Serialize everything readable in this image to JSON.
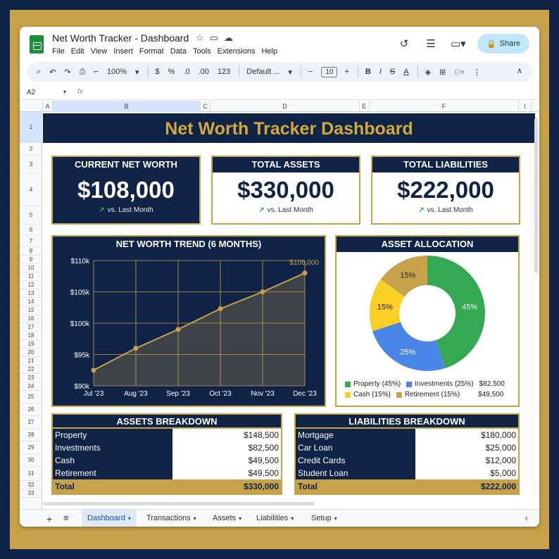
{
  "window": {
    "title": "Net Worth Tracker - Dashboard",
    "share_label": "Share"
  },
  "menu": [
    "File",
    "Edit",
    "View",
    "Insert",
    "Format",
    "Data",
    "Tools",
    "Extensions",
    "Help"
  ],
  "toolbar": {
    "zoom": "100%",
    "currency": "$",
    "percent": "%",
    "dec_decrease": ".0",
    "dec_increase": ".00",
    "number_format": "123",
    "font": "Default ...",
    "font_size": "10"
  },
  "formula_bar": {
    "name_box": "A2",
    "fx": "fx"
  },
  "columns": [
    "A",
    "B",
    "C",
    "D",
    "E",
    "F",
    "I"
  ],
  "rows": [
    "1",
    "2",
    "3",
    "4",
    "5",
    "6",
    "7",
    "8",
    "9",
    "10",
    "11",
    "12",
    "13",
    "14",
    "15",
    "16",
    "17",
    "18",
    "19",
    "20",
    "21",
    "22",
    "23",
    "24",
    "25",
    "26",
    "27",
    "28",
    "29",
    "30",
    "31",
    "32",
    "33"
  ],
  "dashboard": {
    "title": "Net Worth Tracker Dashboard",
    "cards": [
      {
        "label": "CURRENT NET WORTH",
        "value": "$108,000",
        "sub": "vs. Last Month"
      },
      {
        "label": "TOTAL ASSETS",
        "value": "$330,000",
        "sub": "vs. Last Month"
      },
      {
        "label": "TOTAL LIABILITIES",
        "value": "$222,000",
        "sub": "vs. Last Month"
      }
    ],
    "trend_title": "NET WORTH TREND (6 MONTHS)",
    "allocation_title": "ASSET ALLOCATION",
    "allocation_legend": [
      {
        "label": "Property (45%)",
        "color": "#34a853"
      },
      {
        "label": "Investments (25%)",
        "color": "#4a86e8",
        "amount": "$82,500"
      },
      {
        "label": "Cash (15%)",
        "color": "#fbd024"
      },
      {
        "label": "Retirement (15%)",
        "color": "#c8a24a",
        "amount": "$49,500"
      }
    ]
  },
  "chart_data": [
    {
      "type": "line",
      "title": "NET WORTH TREND (6 MONTHS)",
      "categories": [
        "Jul '23",
        "Aug '23",
        "Sep '23",
        "Oct '23",
        "Nov '23",
        "Dec '23"
      ],
      "values": [
        92500,
        96000,
        99000,
        102300,
        105000,
        108000
      ],
      "ylim": [
        90000,
        110000
      ],
      "yticks": [
        "$90k",
        "$95k",
        "$100k",
        "$105k",
        "$110k"
      ],
      "point_label": "$108,000",
      "grid": true,
      "color": "#c8a24a"
    },
    {
      "type": "pie",
      "title": "ASSET ALLOCATION",
      "categories": [
        "Property",
        "Investments",
        "Cash",
        "Retirement"
      ],
      "values": [
        45,
        25,
        15,
        15
      ],
      "labels": [
        "45%",
        "25%",
        "15%",
        "15%"
      ],
      "colors": [
        "#34a853",
        "#4a86e8",
        "#fbd024",
        "#c8a24a"
      ],
      "donut": true
    }
  ],
  "assets": {
    "title": "ASSETS BREAKDOWN",
    "rows": [
      {
        "label": "Property",
        "value": "$148,500"
      },
      {
        "label": "Investments",
        "value": "$82,500"
      },
      {
        "label": "Cash",
        "value": "$49,500"
      },
      {
        "label": "Retirement",
        "value": "$49,500"
      }
    ],
    "total_label": "Total",
    "total_value": "$330,000"
  },
  "liabilities": {
    "title": "LIABILITIES BREAKDOWN",
    "rows": [
      {
        "label": "Mortgage",
        "value": "$180,000"
      },
      {
        "label": "Car Loan",
        "value": "$25,000"
      },
      {
        "label": "Credit Cards",
        "value": "$12,000"
      },
      {
        "label": "Student Loan",
        "value": "$5,000"
      }
    ],
    "total_label": "Total",
    "total_value": "$222,000"
  },
  "tabs": [
    "Dashboard",
    "Transactions",
    "Assets",
    "Liabilities",
    "Setup"
  ],
  "colors": {
    "navy": "#0f2347",
    "gold": "#c8a24a",
    "title_gold": "#d4a93c"
  }
}
